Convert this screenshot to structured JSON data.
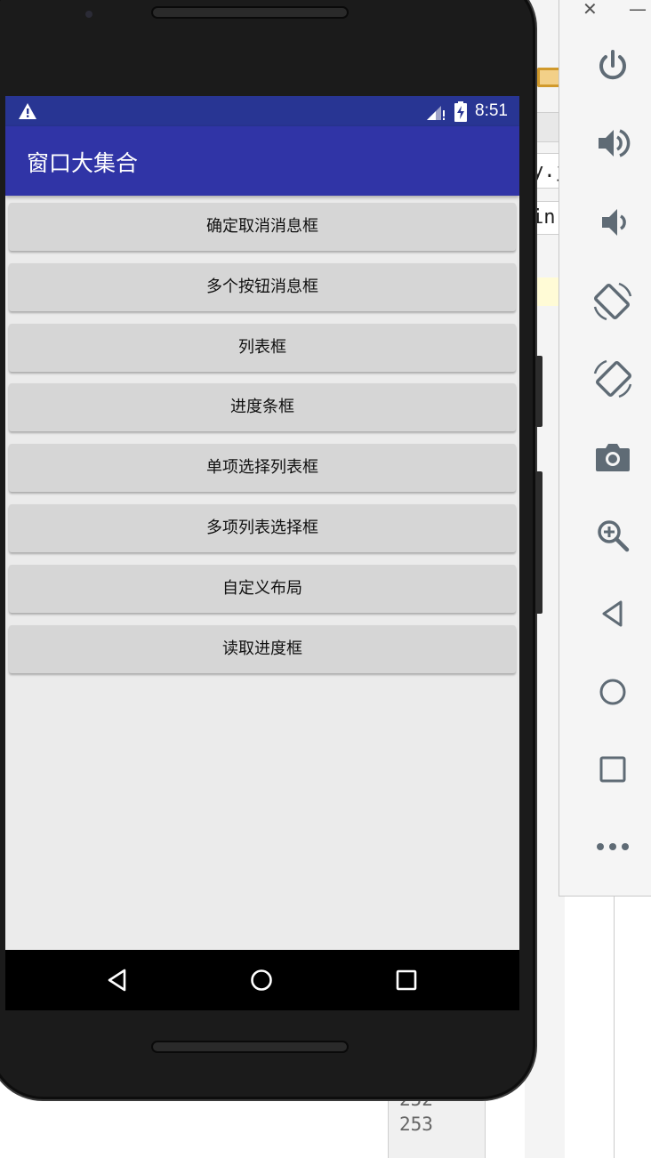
{
  "status_bar": {
    "time": "8:51"
  },
  "app_bar": {
    "title": "窗口大集合"
  },
  "buttons": [
    {
      "label": "确定取消消息框"
    },
    {
      "label": "多个按钮消息框"
    },
    {
      "label": "列表框"
    },
    {
      "label": "进度条框"
    },
    {
      "label": "单项选择列表框"
    },
    {
      "label": "多项列表选择框"
    },
    {
      "label": "自定义布局"
    },
    {
      "label": "读取进度框"
    }
  ],
  "navigation_bar": {
    "icons": [
      "back-icon",
      "home-icon",
      "recents-icon"
    ]
  },
  "emulator_toolbar": {
    "window_controls": [
      "close-icon",
      "minimize-icon"
    ],
    "icons": [
      "power-icon",
      "volume-up-icon",
      "volume-down-icon",
      "rotate-left-icon",
      "rotate-right-icon",
      "camera-icon",
      "zoom-icon",
      "back-icon",
      "home-icon",
      "overview-icon",
      "more-icon"
    ]
  },
  "background": {
    "ide_fragments": [
      "y.j",
      "in"
    ],
    "line_numbers": [
      "252",
      "253"
    ]
  },
  "colors": {
    "status_bar": "#283593",
    "app_bar": "#3034a6",
    "screen_bg": "#ebebeb",
    "button_bg": "#d6d6d6",
    "toolbar_icon": "#5f6b75"
  }
}
